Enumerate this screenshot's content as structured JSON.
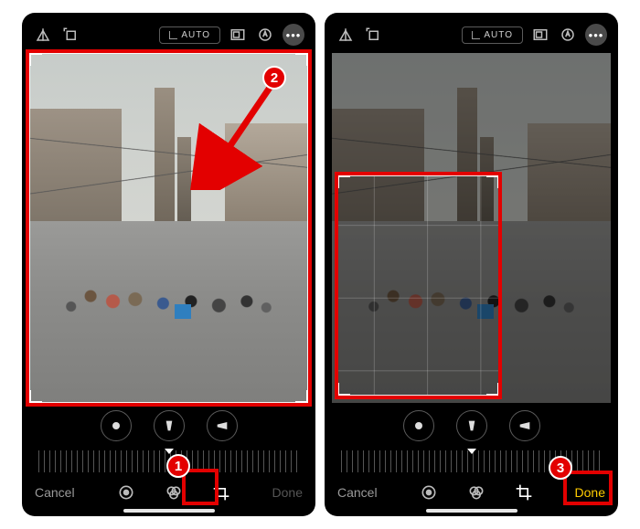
{
  "topbar": {
    "auto_label": "AUTO"
  },
  "bottombar": {
    "cancel_label": "Cancel",
    "done_label": "Done"
  },
  "annotations": {
    "step1": "1",
    "step2": "2",
    "step3": "3"
  },
  "colors": {
    "annotation_red": "#e30000",
    "done_active": "#ffcc00"
  }
}
